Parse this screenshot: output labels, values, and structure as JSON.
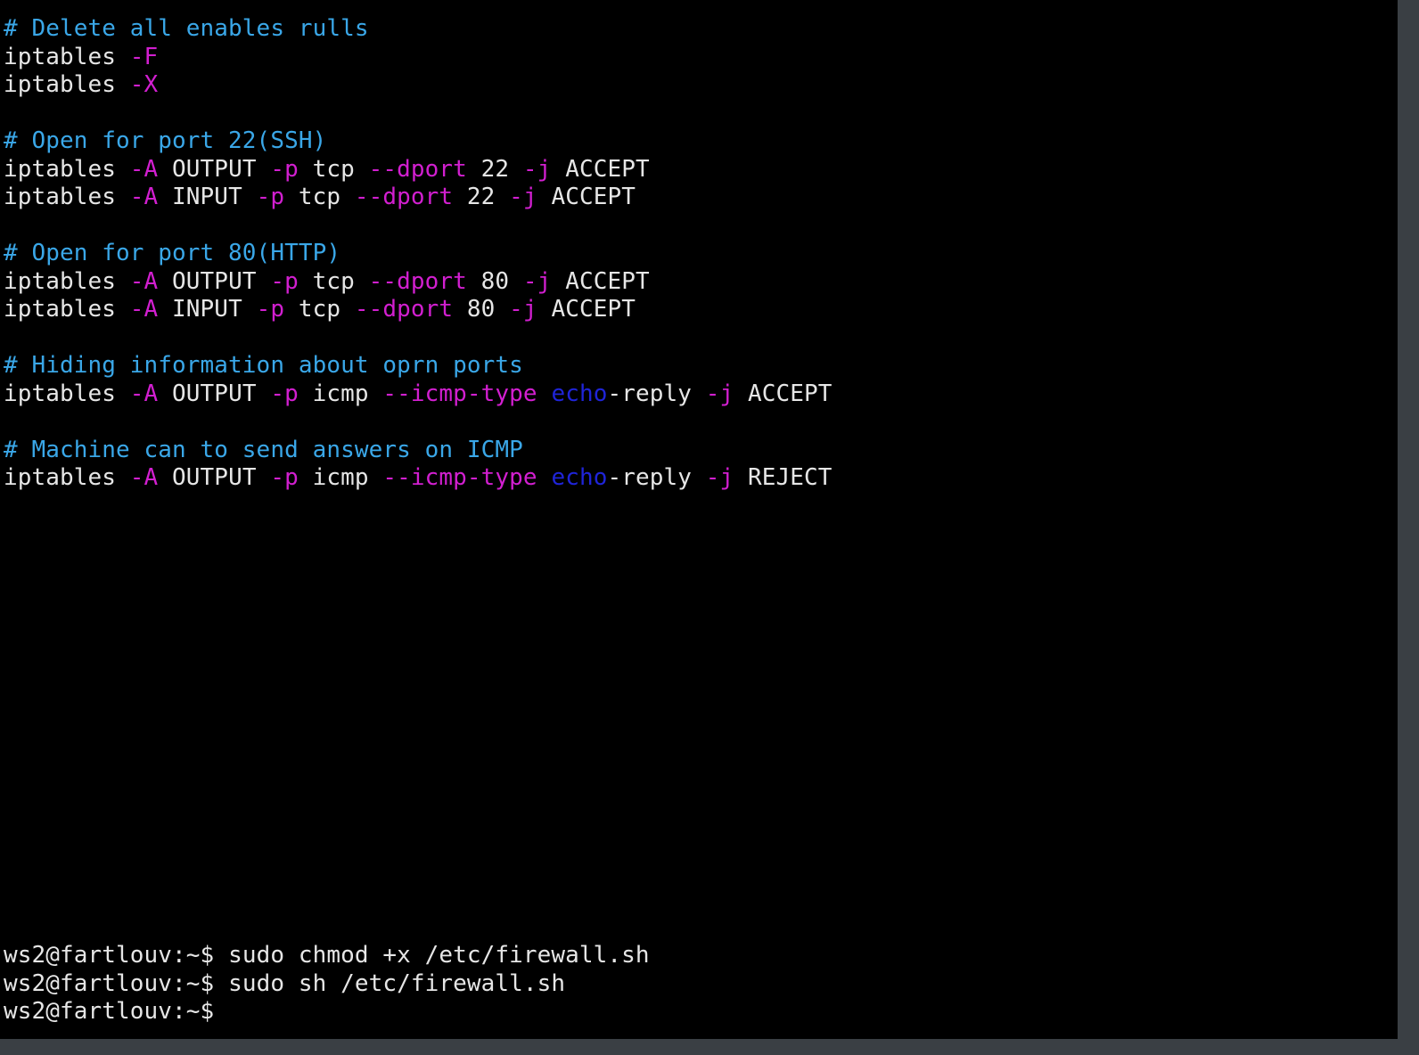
{
  "colors": {
    "background": "#000000",
    "comment": "#3aa7e8",
    "plain": "#e6e6e6",
    "flag": "#d21fd0",
    "keyword": "#1f24d8"
  },
  "script_lines": [
    [
      {
        "t": "# Delete all enables rulls",
        "c": "comment"
      }
    ],
    [
      {
        "t": "iptables ",
        "c": "plain"
      },
      {
        "t": "-F",
        "c": "flag"
      }
    ],
    [
      {
        "t": "iptables ",
        "c": "plain"
      },
      {
        "t": "-X",
        "c": "flag"
      }
    ],
    [],
    [
      {
        "t": "# Open for port 22(SSH)",
        "c": "comment"
      }
    ],
    [
      {
        "t": "iptables ",
        "c": "plain"
      },
      {
        "t": "-A",
        "c": "flag"
      },
      {
        "t": " OUTPUT ",
        "c": "plain"
      },
      {
        "t": "-p",
        "c": "flag"
      },
      {
        "t": " tcp ",
        "c": "plain"
      },
      {
        "t": "--dport",
        "c": "flag"
      },
      {
        "t": " 22 ",
        "c": "plain"
      },
      {
        "t": "-j",
        "c": "flag"
      },
      {
        "t": " ACCEPT",
        "c": "plain"
      }
    ],
    [
      {
        "t": "iptables ",
        "c": "plain"
      },
      {
        "t": "-A",
        "c": "flag"
      },
      {
        "t": " INPUT ",
        "c": "plain"
      },
      {
        "t": "-p",
        "c": "flag"
      },
      {
        "t": " tcp ",
        "c": "plain"
      },
      {
        "t": "--dport",
        "c": "flag"
      },
      {
        "t": " 22 ",
        "c": "plain"
      },
      {
        "t": "-j",
        "c": "flag"
      },
      {
        "t": " ACCEPT",
        "c": "plain"
      }
    ],
    [],
    [
      {
        "t": "# Open for port 80(HTTP)",
        "c": "comment"
      }
    ],
    [
      {
        "t": "iptables ",
        "c": "plain"
      },
      {
        "t": "-A",
        "c": "flag"
      },
      {
        "t": " OUTPUT ",
        "c": "plain"
      },
      {
        "t": "-p",
        "c": "flag"
      },
      {
        "t": " tcp ",
        "c": "plain"
      },
      {
        "t": "--dport",
        "c": "flag"
      },
      {
        "t": " 80 ",
        "c": "plain"
      },
      {
        "t": "-j",
        "c": "flag"
      },
      {
        "t": " ACCEPT",
        "c": "plain"
      }
    ],
    [
      {
        "t": "iptables ",
        "c": "plain"
      },
      {
        "t": "-A",
        "c": "flag"
      },
      {
        "t": " INPUT ",
        "c": "plain"
      },
      {
        "t": "-p",
        "c": "flag"
      },
      {
        "t": " tcp ",
        "c": "plain"
      },
      {
        "t": "--dport",
        "c": "flag"
      },
      {
        "t": " 80 ",
        "c": "plain"
      },
      {
        "t": "-j",
        "c": "flag"
      },
      {
        "t": " ACCEPT",
        "c": "plain"
      }
    ],
    [],
    [
      {
        "t": "# Hiding information about oprn ports",
        "c": "comment"
      }
    ],
    [
      {
        "t": "iptables ",
        "c": "plain"
      },
      {
        "t": "-A",
        "c": "flag"
      },
      {
        "t": " OUTPUT ",
        "c": "plain"
      },
      {
        "t": "-p",
        "c": "flag"
      },
      {
        "t": " icmp ",
        "c": "plain"
      },
      {
        "t": "--icmp-type",
        "c": "flag"
      },
      {
        "t": " ",
        "c": "plain"
      },
      {
        "t": "echo",
        "c": "keyword"
      },
      {
        "t": "-reply ",
        "c": "plain"
      },
      {
        "t": "-j",
        "c": "flag"
      },
      {
        "t": " ACCEPT",
        "c": "plain"
      }
    ],
    [],
    [
      {
        "t": "# Machine can to send answers on ICMP",
        "c": "comment"
      }
    ],
    [
      {
        "t": "iptables ",
        "c": "plain"
      },
      {
        "t": "-A",
        "c": "flag"
      },
      {
        "t": " OUTPUT ",
        "c": "plain"
      },
      {
        "t": "-p",
        "c": "flag"
      },
      {
        "t": " icmp ",
        "c": "plain"
      },
      {
        "t": "--icmp-type",
        "c": "flag"
      },
      {
        "t": " ",
        "c": "plain"
      },
      {
        "t": "echo",
        "c": "keyword"
      },
      {
        "t": "-reply ",
        "c": "plain"
      },
      {
        "t": "-j",
        "c": "flag"
      },
      {
        "t": " REJECT",
        "c": "plain"
      }
    ]
  ],
  "shell_lines": [
    {
      "prompt": "ws2@fartlouv:~$",
      "command": " sudo chmod +x /etc/firewall.sh"
    },
    {
      "prompt": "ws2@fartlouv:~$",
      "command": " sudo sh /etc/firewall.sh"
    },
    {
      "prompt": "ws2@fartlouv:~$",
      "command": ""
    }
  ]
}
